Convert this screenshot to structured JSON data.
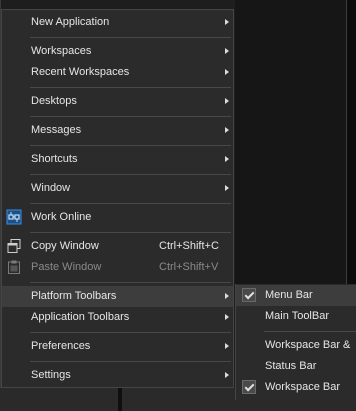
{
  "menu": {
    "items": [
      {
        "label": "New Application",
        "submenu": true
      },
      {
        "label": "Workspaces",
        "submenu": true
      },
      {
        "label": "Recent Workspaces",
        "submenu": true
      },
      {
        "label": "Desktops",
        "submenu": true
      },
      {
        "label": "Messages",
        "submenu": true
      },
      {
        "label": "Shortcuts",
        "submenu": true
      },
      {
        "label": "Window",
        "submenu": true
      },
      {
        "label": "Work Online",
        "icon": "network-link-icon"
      },
      {
        "label": "Copy Window",
        "shortcut": "Ctrl+Shift+C",
        "icon": "copy-window-icon"
      },
      {
        "label": "Paste Window",
        "shortcut": "Ctrl+Shift+V",
        "icon": "paste-window-icon",
        "disabled": true
      },
      {
        "label": "Platform Toolbars",
        "submenu": true,
        "highlighted": true
      },
      {
        "label": "Application Toolbars",
        "submenu": true
      },
      {
        "label": "Preferences",
        "submenu": true
      },
      {
        "label": "Settings",
        "submenu": true
      }
    ]
  },
  "submenu": {
    "items": [
      {
        "label": "Menu Bar",
        "checked": true
      },
      {
        "label": "Main ToolBar",
        "checked": false
      },
      {
        "label": "Workspace Bar &",
        "checked": false
      },
      {
        "label": "Status Bar",
        "checked": false
      },
      {
        "label": "Workspace Bar",
        "checked": true
      }
    ]
  },
  "colors": {
    "menu_bg": "#2b2b2b",
    "highlight": "#3d3d3d",
    "text": "#e6e6e6",
    "disabled_text": "#8a8a8a",
    "icon_blue": "#3a8ee6"
  }
}
